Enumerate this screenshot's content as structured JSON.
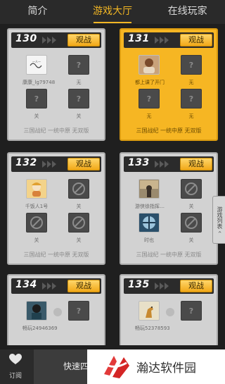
{
  "tabs": [
    {
      "label": "简介",
      "active": false
    },
    {
      "label": "游戏大厅",
      "active": true
    },
    {
      "label": "在线玩家",
      "active": false
    }
  ],
  "accent_color": "#f2b624",
  "rooms": [
    {
      "number": "130",
      "watch_label": "观战",
      "featured": false,
      "slots": [
        {
          "state": "photo",
          "label": "康康_lg79748"
        },
        {
          "state": "empty",
          "icon": "?",
          "label": "无"
        },
        {
          "state": "empty",
          "icon": "?",
          "label": "关"
        },
        {
          "state": "empty",
          "icon": "?",
          "label": "关"
        }
      ],
      "footer": "三国战纪 一统中原 无双版"
    },
    {
      "number": "131",
      "watch_label": "观战",
      "featured": true,
      "slots": [
        {
          "state": "photo",
          "label": "都上课了开门"
        },
        {
          "state": "empty",
          "icon": "?",
          "label": "无"
        },
        {
          "state": "empty",
          "icon": "?",
          "label": "无"
        },
        {
          "state": "empty",
          "icon": "?",
          "label": "无"
        }
      ],
      "footer": "三国战纪 一统中原 无双版"
    },
    {
      "number": "132",
      "watch_label": "观战",
      "featured": false,
      "slots": [
        {
          "state": "photo",
          "label": "千饭人1号"
        },
        {
          "state": "forbid",
          "label": "关"
        },
        {
          "state": "forbid",
          "label": "关"
        },
        {
          "state": "forbid",
          "label": "关"
        }
      ],
      "footer": "三国战纪 一统中原 无双版"
    },
    {
      "number": "133",
      "watch_label": "观战",
      "featured": false,
      "slots": [
        {
          "state": "photo",
          "label": "游侠徐指挥…"
        },
        {
          "state": "forbid",
          "label": "关"
        },
        {
          "state": "photo",
          "label": "时也"
        },
        {
          "state": "forbid",
          "label": "关"
        }
      ],
      "footer": "三国战纪 一统中原 无双版"
    },
    {
      "number": "134",
      "watch_label": "观战",
      "featured": false,
      "slots": [
        {
          "state": "photo",
          "label": "畅玩24946369"
        },
        {
          "state": "empty",
          "icon": "?",
          "label": ""
        }
      ],
      "footer": ""
    },
    {
      "number": "135",
      "watch_label": "观战",
      "featured": false,
      "slots": [
        {
          "state": "photo",
          "label": "畅玩52378593"
        },
        {
          "state": "empty",
          "icon": "?",
          "label": ""
        }
      ],
      "footer": ""
    }
  ],
  "side_tab": {
    "label": "游戏列表",
    "icon": "chevron-left-icon"
  },
  "bottom_bar": {
    "subscribe_label": "订阅",
    "quick_label": "快速四"
  },
  "watermark": {
    "text": "瀚达软件园"
  }
}
